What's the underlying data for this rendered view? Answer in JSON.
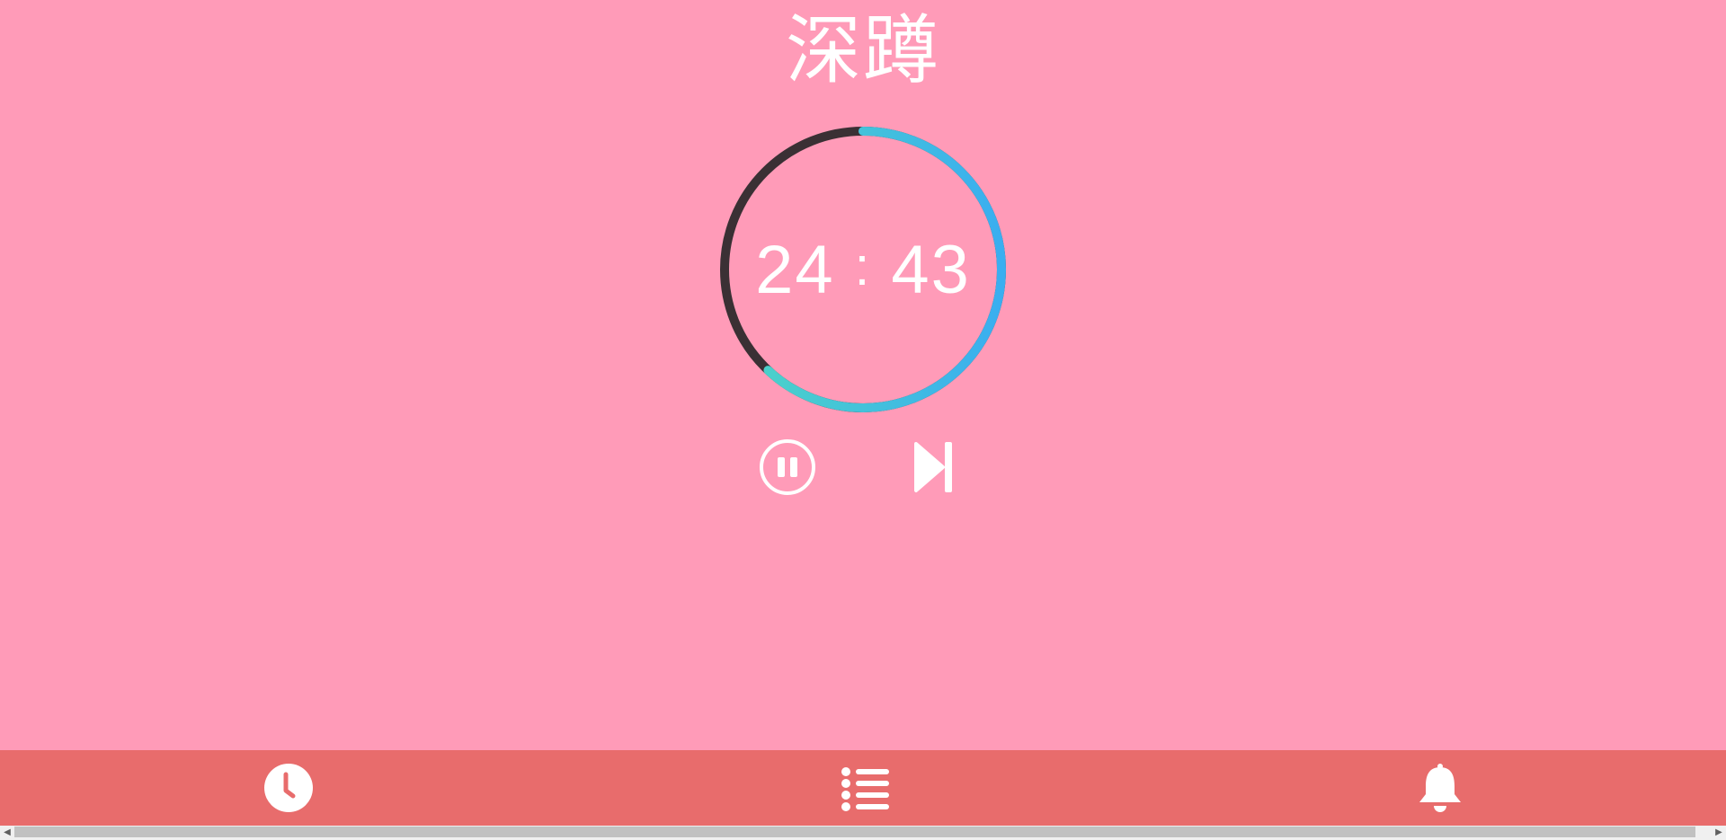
{
  "exercise": {
    "title": "深蹲"
  },
  "timer": {
    "minutes": "24",
    "separator": ":",
    "seconds": "43",
    "progress_fraction": 0.62,
    "colors": {
      "track": "#3a3034",
      "progress_start": "#4dd6c4",
      "progress_end": "#3aaef0"
    }
  },
  "controls": {
    "pause": {
      "icon": "pause-circle-icon"
    },
    "skip": {
      "icon": "skip-next-icon"
    }
  },
  "bottom_nav": {
    "items": [
      {
        "icon": "clock-icon"
      },
      {
        "icon": "list-icon"
      },
      {
        "icon": "bell-icon"
      }
    ]
  },
  "colors": {
    "background": "#ff9bb8",
    "bottom_bar": "#e86c6c",
    "foreground": "#ffffff"
  }
}
